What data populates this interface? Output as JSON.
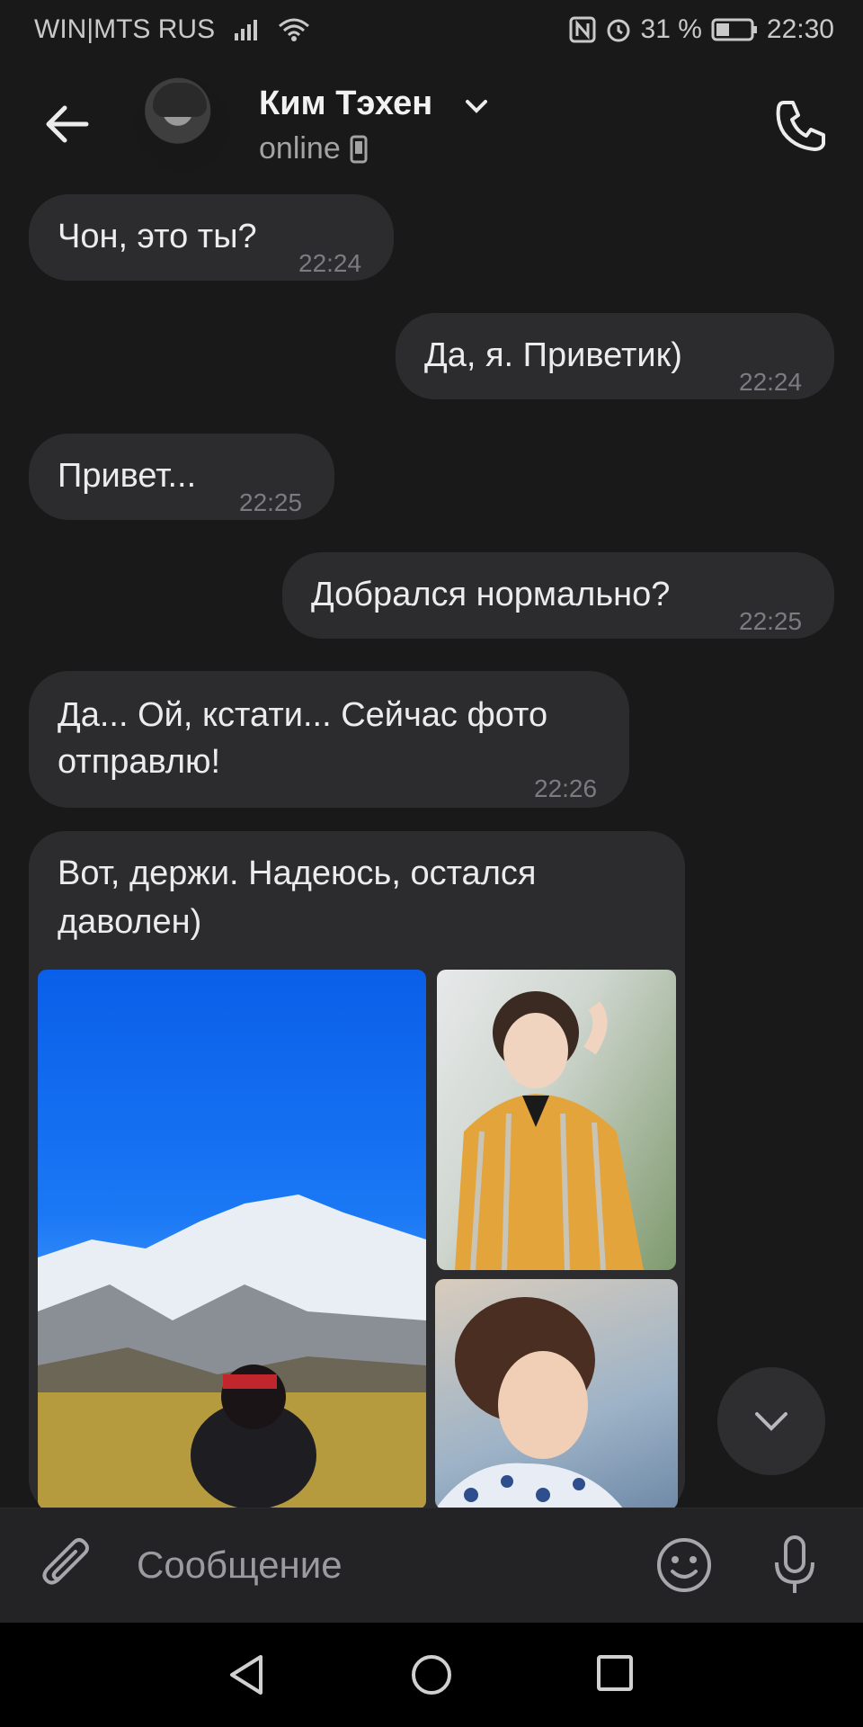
{
  "status_bar": {
    "carrier": "WIN|MTS RUS",
    "battery_percent": "31 %",
    "time": "22:30"
  },
  "header": {
    "contact_name": "Ким Тэхен",
    "status": "online"
  },
  "messages": [
    {
      "direction": "incoming",
      "text": "Чон, это ты?",
      "time": "22:24"
    },
    {
      "direction": "outgoing",
      "text": "Да, я. Приветик)",
      "time": "22:24"
    },
    {
      "direction": "incoming",
      "text": "Привет...",
      "time": "22:25"
    },
    {
      "direction": "outgoing",
      "text": "Добрался нормально?",
      "time": "22:25"
    },
    {
      "direction": "incoming",
      "text_line1": "Да... Ой, кстати... Сейчас фото",
      "text_line2": "отправлю!",
      "time": "22:26"
    },
    {
      "direction": "incoming",
      "text_line1": "Вот, держи. Надеюсь, остался",
      "text_line2": "даволен)",
      "attachments": 3
    }
  ],
  "composer": {
    "placeholder": "Сообщение"
  },
  "colors": {
    "background": "#19191a",
    "bubble": "#2c2c2f",
    "text": "#ececec",
    "time": "#7c7c80"
  },
  "icons": [
    "back-arrow-icon",
    "chevron-down-icon",
    "phone-icon",
    "mobile-device-icon",
    "paperclip-icon",
    "emoji-icon",
    "microphone-icon",
    "scroll-down-icon",
    "nav-back-icon",
    "nav-home-icon",
    "nav-recents-icon"
  ]
}
